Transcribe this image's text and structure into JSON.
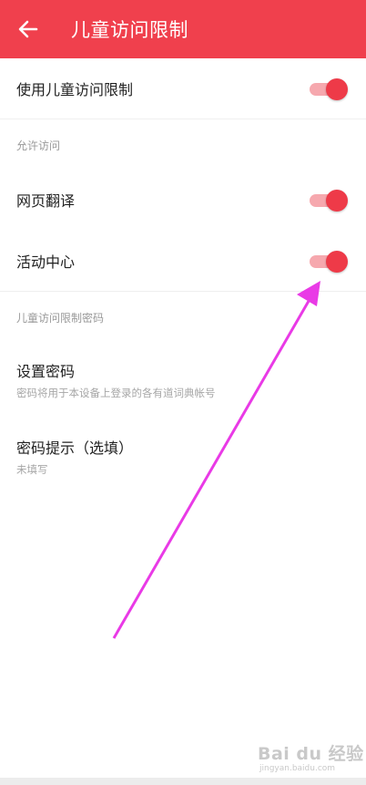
{
  "header": {
    "back_icon": "arrow-left-icon",
    "title": "儿童访问限制",
    "color": "#f0404d"
  },
  "master_toggle": {
    "label": "使用儿童访问限制",
    "checked": true
  },
  "allowed_section": {
    "title": "允许访问",
    "items": [
      {
        "label": "网页翻译",
        "checked": true
      },
      {
        "label": "活动中心",
        "checked": true
      }
    ]
  },
  "password_section": {
    "title": "儿童访问限制密码",
    "set_password": {
      "title": "设置密码",
      "subtitle": "密码将用于本设备上登录的各有道词典帐号"
    },
    "hint": {
      "title": "密码提示（选填）",
      "subtitle": "未填写"
    }
  },
  "toggle_colors": {
    "knob": "#ee3a48",
    "track": "#f6a8ae"
  },
  "annotation_arrow_color": "#e93ae6",
  "watermark": {
    "brand": "Bai du 经验",
    "sub": "jingyan.baidu.com"
  }
}
